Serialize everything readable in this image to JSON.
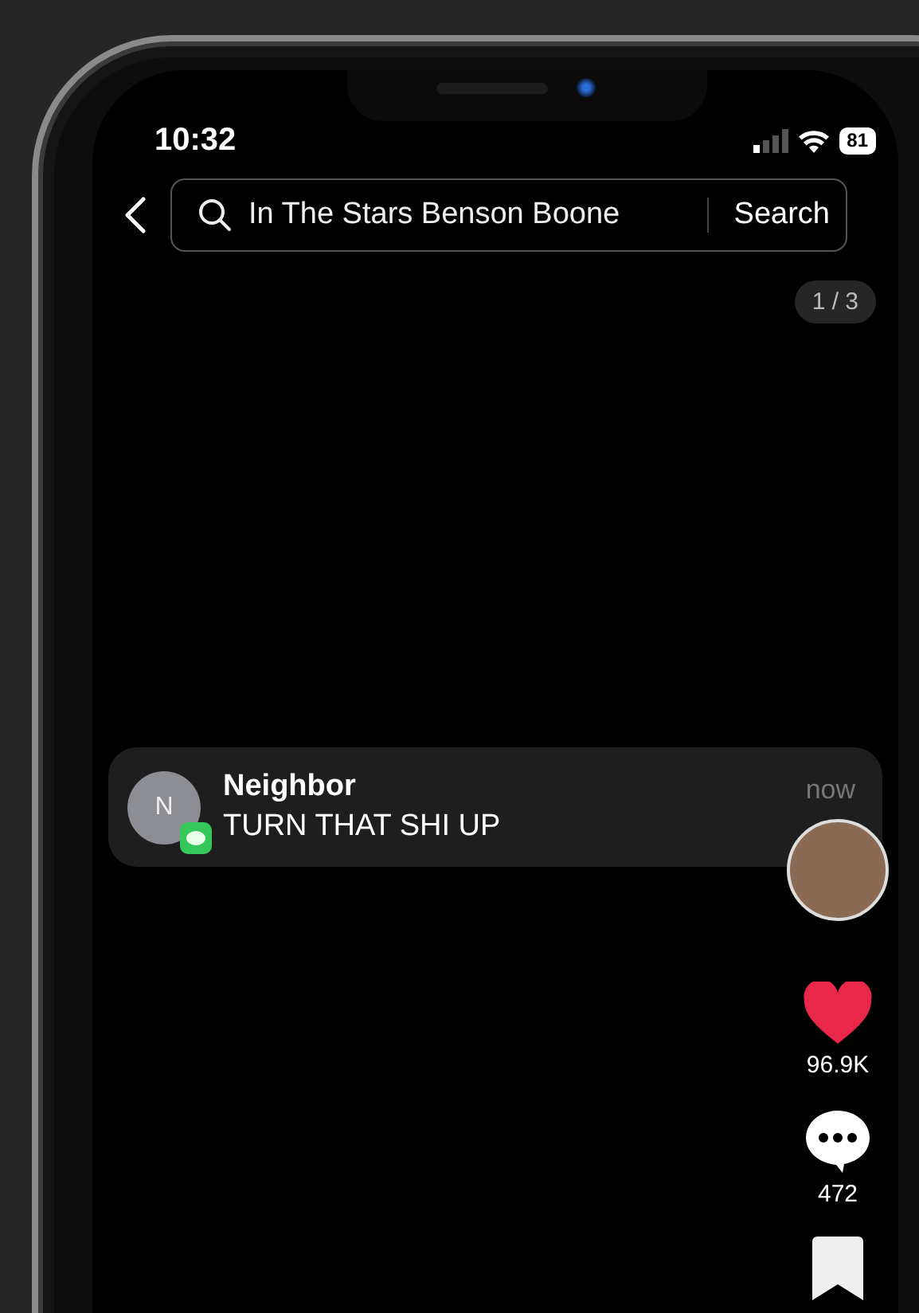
{
  "status_bar": {
    "time": "10:32",
    "battery": "81"
  },
  "search": {
    "query": "In The Stars Benson Boone",
    "button": "Search"
  },
  "counter": "1 / 3",
  "notification": {
    "initial": "N",
    "sender": "Neighbor",
    "message": "TURN THAT SHI UP",
    "time": "now"
  },
  "actions": [
    {
      "kind": "like",
      "count": "96.9K",
      "liked": true
    },
    {
      "kind": "comment",
      "count": "472"
    },
    {
      "kind": "bookmark"
    }
  ]
}
